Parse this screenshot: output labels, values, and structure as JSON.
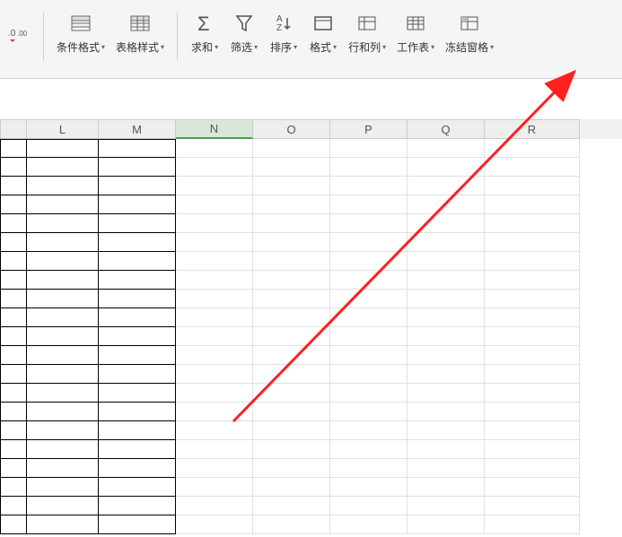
{
  "ribbon": {
    "groups": [
      {
        "id": "conditional-format",
        "label": "条件格式",
        "icon": "cond-format-icon"
      },
      {
        "id": "table-style",
        "label": "表格样式",
        "icon": "table-style-icon"
      },
      {
        "id": "sum",
        "label": "求和",
        "icon": "sum-icon"
      },
      {
        "id": "filter",
        "label": "筛选",
        "icon": "filter-icon"
      },
      {
        "id": "sort",
        "label": "排序",
        "icon": "sort-icon"
      },
      {
        "id": "format",
        "label": "格式",
        "icon": "format-icon"
      },
      {
        "id": "rows-cols",
        "label": "行和列",
        "icon": "rows-cols-icon"
      },
      {
        "id": "worksheet",
        "label": "工作表",
        "icon": "worksheet-icon"
      },
      {
        "id": "freeze-panes",
        "label": "冻结窗格",
        "icon": "freeze-icon"
      }
    ]
  },
  "columns": [
    {
      "letter": "",
      "width": "w-narrow"
    },
    {
      "letter": "L",
      "width": "w-l"
    },
    {
      "letter": "M",
      "width": "w-m"
    },
    {
      "letter": "N",
      "width": "w-n",
      "selected": true
    },
    {
      "letter": "O",
      "width": "w-o"
    },
    {
      "letter": "P",
      "width": "w-p"
    },
    {
      "letter": "Q",
      "width": "w-q"
    },
    {
      "letter": "R",
      "width": "w-r"
    }
  ],
  "row_count": 21,
  "bordered_cols": [
    0,
    1,
    2
  ]
}
